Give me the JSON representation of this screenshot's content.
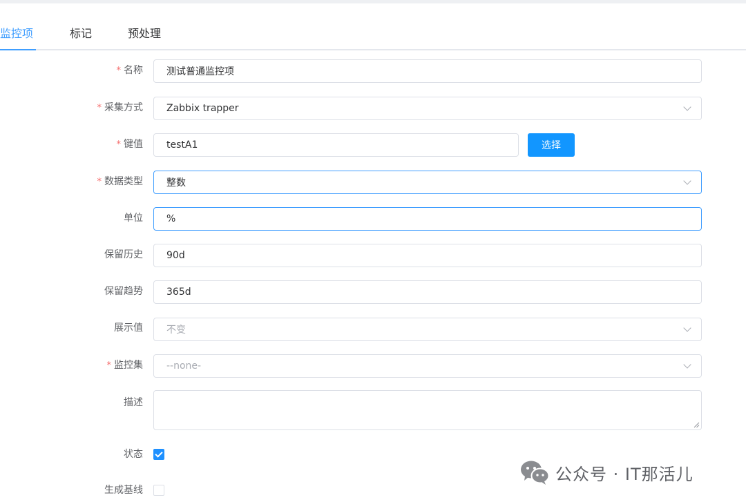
{
  "tabs": [
    {
      "label": "监控项",
      "active": true
    },
    {
      "label": "标记",
      "active": false
    },
    {
      "label": "预处理",
      "active": false
    }
  ],
  "form": {
    "name": {
      "label": "名称",
      "required": true,
      "value": "测试普通监控项"
    },
    "collect_method": {
      "label": "采集方式",
      "required": true,
      "value": "Zabbix trapper"
    },
    "key": {
      "label": "键值",
      "required": true,
      "value": "testA1",
      "button_label": "选择"
    },
    "data_type": {
      "label": "数据类型",
      "required": true,
      "value": "整数"
    },
    "unit": {
      "label": "单位",
      "required": false,
      "value": "%"
    },
    "history": {
      "label": "保留历史",
      "required": false,
      "value": "90d"
    },
    "trend": {
      "label": "保留趋势",
      "required": false,
      "value": "365d"
    },
    "display_value": {
      "label": "展示值",
      "required": false,
      "placeholder": "不变"
    },
    "monitor_set": {
      "label": "监控集",
      "required": true,
      "placeholder": "--none-"
    },
    "description": {
      "label": "描述",
      "required": false,
      "value": ""
    },
    "status": {
      "label": "状态",
      "required": false,
      "checked": true
    },
    "baseline": {
      "label": "生成基线",
      "required": false,
      "checked": false
    }
  },
  "required_mark": "*",
  "watermark": {
    "text": "公众号 · IT那活儿",
    "icon": "wechat-icon"
  },
  "colors": {
    "accent": "#409eff",
    "button": "#1296ff",
    "required": "#f56c6c",
    "checkbox": "#1e90ff"
  }
}
